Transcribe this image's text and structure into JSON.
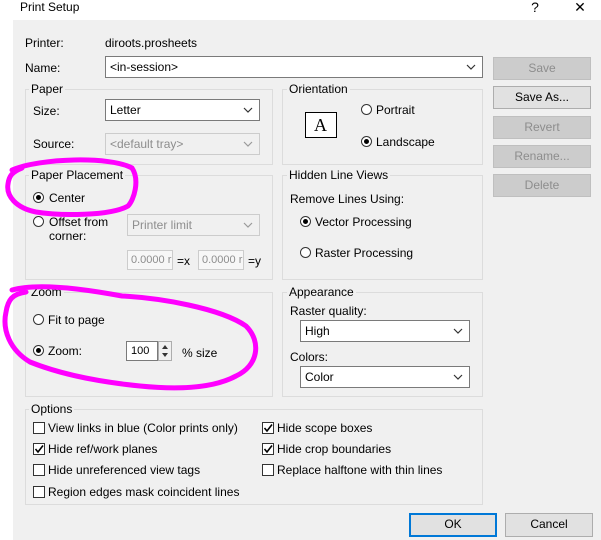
{
  "window": {
    "title": "Print Setup",
    "help_glyph": "?",
    "close_glyph": "✕"
  },
  "printer": {
    "label": "Printer:",
    "value": "diroots.prosheets",
    "name_label": "Name:",
    "name_value": "<in-session>"
  },
  "buttons": {
    "save": "Save",
    "save_as": "Save As...",
    "revert": "Revert",
    "rename": "Rename...",
    "delete": "Delete",
    "ok": "OK",
    "cancel": "Cancel"
  },
  "paper": {
    "title": "Paper",
    "size_label": "Size:",
    "size_value": "Letter",
    "source_label": "Source:",
    "source_value": "<default tray>"
  },
  "orientation": {
    "title": "Orientation",
    "portrait": "Portrait",
    "landscape": "Landscape",
    "selected": "landscape",
    "icon_letter": "A"
  },
  "placement": {
    "title": "Paper Placement",
    "center": "Center",
    "offset_line1": "Offset from",
    "offset_line2": "corner:",
    "offset_select": "Printer limit",
    "x_value": "0.0000 r",
    "x_label": "=x",
    "y_value": "0.0000 r",
    "y_label": "=y",
    "selected": "center"
  },
  "hidden_lines": {
    "title": "Hidden Line Views",
    "remove_label": "Remove Lines Using:",
    "vector": "Vector Processing",
    "raster": "Raster Processing",
    "selected": "vector"
  },
  "zoom": {
    "title": "Zoom",
    "fit": "Fit to page",
    "zoom_label": "Zoom:",
    "zoom_value": "100",
    "unit": "% size",
    "selected": "zoom"
  },
  "appearance": {
    "title": "Appearance",
    "quality_label": "Raster quality:",
    "quality_value": "High",
    "colors_label": "Colors:",
    "colors_value": "Color"
  },
  "options": {
    "title": "Options",
    "items": [
      {
        "label": "View links in blue (Color prints only)",
        "checked": false
      },
      {
        "label": "Hide scope boxes",
        "checked": true
      },
      {
        "label": "Hide ref/work planes",
        "checked": true
      },
      {
        "label": "Hide crop boundaries",
        "checked": true
      },
      {
        "label": "Hide unreferenced view tags",
        "checked": false
      },
      {
        "label": "Replace halftone with thin lines",
        "checked": false
      },
      {
        "label": "Region edges mask coincident lines",
        "checked": false
      }
    ]
  },
  "annotation_color": "#ff00ff"
}
